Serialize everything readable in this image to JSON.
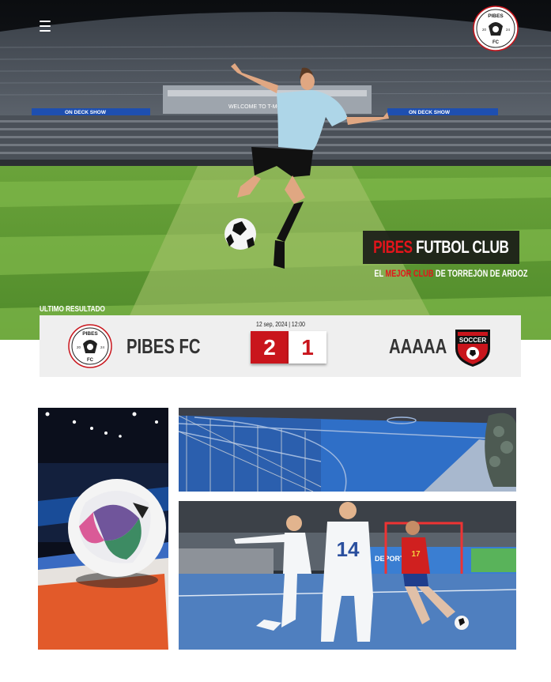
{
  "header": {
    "menu_icon": "hamburger-menu-icon",
    "logo": {
      "icon": "pibes-fc-crest",
      "text_top": "PIBES",
      "text_bottom": "FC",
      "year_left": "20",
      "year_right": "24"
    }
  },
  "hero": {
    "stadium_banner_1": "ON DECK SHOW",
    "stadium_banner_2": "WELCOME TO T-MOBILE",
    "title_red": "PIBES",
    "title_white": "FUTBOL CLUB",
    "tagline_1": "EL ",
    "tagline_red": "MEJOR CLUB",
    "tagline_2": " DE TORREJÓN DE ARDOZ"
  },
  "last_result": {
    "label": "ULTIMO RESULTADO",
    "date": "12 sep, 2024 | 12:00",
    "home_team": "PIBES FC",
    "home_score": "2",
    "away_team": "AAAAA",
    "away_score": "1",
    "away_logo": {
      "icon": "soccer-shield-crest",
      "text": "SOCCER"
    }
  },
  "gallery": {
    "images": [
      "futsal-ball-photo",
      "futsal-court-photo",
      "futsal-match-photo"
    ],
    "player_number": "14",
    "player_number_2": "17",
    "court_banner": "DEPORTE"
  },
  "colors": {
    "accent_red": "#e3141b",
    "score_red": "#c9151c",
    "card_bg": "#efefef",
    "court_blue": "#2f6fc7"
  }
}
